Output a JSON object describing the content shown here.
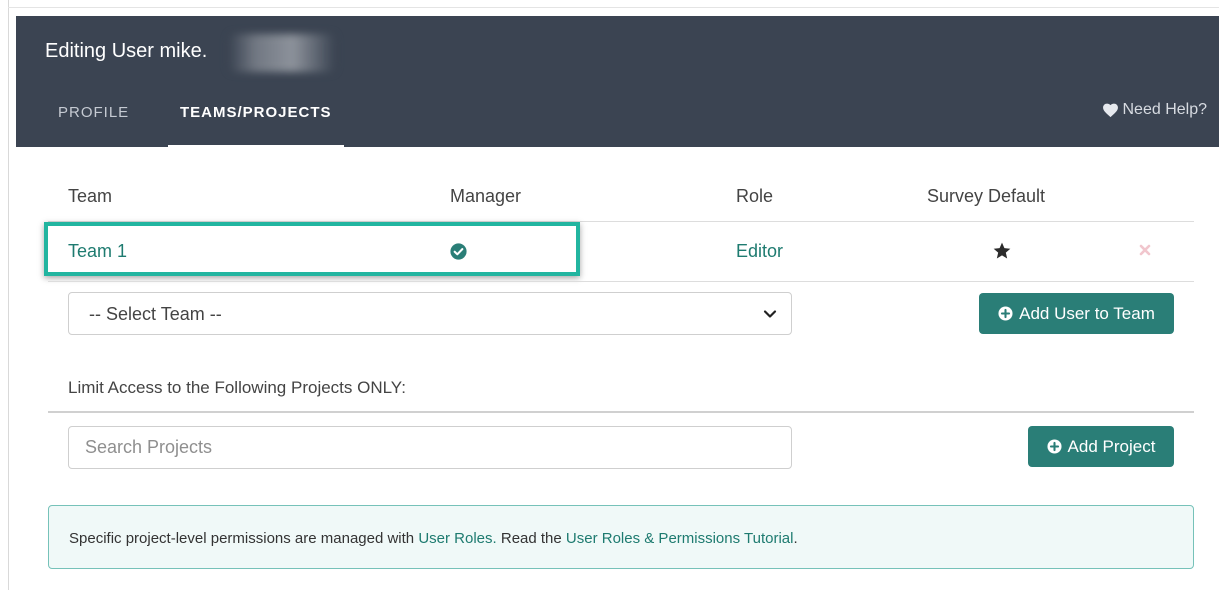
{
  "header": {
    "title": "Editing User mike.",
    "tabs": [
      {
        "label": "PROFILE",
        "active": false
      },
      {
        "label": "TEAMS/PROJECTS",
        "active": true
      }
    ],
    "help_label": "Need Help?",
    "background": "#3b4452"
  },
  "teams_table": {
    "columns": [
      "Team",
      "Manager",
      "Role",
      "Survey Default"
    ],
    "rows": [
      {
        "team": "Team 1",
        "manager_icon": "check-circle-icon",
        "role": "Editor",
        "default_icon": "star-icon",
        "remove_icon": "close-icon"
      }
    ]
  },
  "team_select": {
    "selected": "-- Select Team --"
  },
  "add_team_button": {
    "label": "Add User to Team",
    "icon": "plus-circle-icon"
  },
  "projects": {
    "limit_label": "Limit Access to the Following Projects ONLY:",
    "search_placeholder": "Search Projects",
    "add_button": {
      "label": "Add Project",
      "icon": "plus-circle-icon"
    }
  },
  "info": {
    "text_1": "Specific project-level permissions are managed with ",
    "link_1": "User Roles.",
    "text_2": " Read the ",
    "link_2": "User Roles & Permissions Tutorial",
    "text_3": "."
  },
  "colors": {
    "accent": "#2a7e77",
    "link": "#1e7b70",
    "highlight": "#22b5a0",
    "info_bg": "#f0f9f8"
  }
}
